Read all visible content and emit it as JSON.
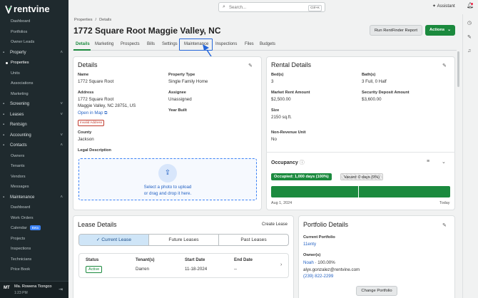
{
  "app": {
    "logo_text": "rentvine"
  },
  "sidebar": {
    "items": [
      {
        "type": "sub",
        "label": "Dashboard"
      },
      {
        "type": "sub",
        "label": "Portfolios"
      },
      {
        "type": "sub",
        "label": "Owner Leads"
      },
      {
        "type": "head",
        "label": "Property",
        "icon": "building-icon",
        "chev": "˄"
      },
      {
        "type": "sub",
        "label": "Properties",
        "active": true
      },
      {
        "type": "sub",
        "label": "Units"
      },
      {
        "type": "sub",
        "label": "Associations"
      },
      {
        "type": "sub",
        "label": "Marketing"
      },
      {
        "type": "head",
        "label": "Screening",
        "icon": "filter-icon",
        "chev": "˅"
      },
      {
        "type": "head",
        "label": "Leases",
        "icon": "document-icon",
        "chev": "˅"
      },
      {
        "type": "head",
        "label": "Rentsign",
        "icon": "signature-icon",
        "chev": ""
      },
      {
        "type": "head",
        "label": "Accounting",
        "icon": "calculator-icon",
        "chev": "˅"
      },
      {
        "type": "head",
        "label": "Contacts",
        "icon": "contacts-icon",
        "chev": "˄"
      },
      {
        "type": "sub",
        "label": "Owners"
      },
      {
        "type": "sub",
        "label": "Tenants"
      },
      {
        "type": "sub",
        "label": "Vendors"
      },
      {
        "type": "sub",
        "label": "Messages"
      },
      {
        "type": "head",
        "label": "Maintenance",
        "icon": "wrench-icon",
        "chev": "˄"
      },
      {
        "type": "sub",
        "label": "Dashboard"
      },
      {
        "type": "sub",
        "label": "Work Orders"
      },
      {
        "type": "sub",
        "label": "Calendar",
        "badge": "Beta"
      },
      {
        "type": "sub",
        "label": "Projects"
      },
      {
        "type": "sub",
        "label": "Inspections"
      },
      {
        "type": "sub",
        "label": "Technicians"
      },
      {
        "type": "sub",
        "label": "Price Book"
      }
    ],
    "user": {
      "initials": "MT",
      "name": "Ma. Rowena Tiongco",
      "time": "1:23 PM"
    }
  },
  "topbar": {
    "search_placeholder": "Search...",
    "shortcut": "Ctrl+K",
    "assistant_label": "Assistant"
  },
  "breadcrumb": {
    "root": "Properties",
    "current": "Details"
  },
  "header": {
    "title": "1772 Square Root Maggie Valley, NC",
    "rentfinder_button": "Run RentFinder Report",
    "actions_button": "Actions"
  },
  "tabs": [
    "Details",
    "Marketing",
    "Prospects",
    "Bills",
    "Settings",
    "Maintenance",
    "Inspections",
    "Files",
    "Budgets"
  ],
  "details": {
    "title": "Details",
    "name_label": "Name",
    "name": "1772 Square Root",
    "address_label": "Address",
    "address_line1": "1772 Square Root",
    "address_line2": "Maggie Valley, NC 28751, US",
    "open_map": "Open in Map",
    "invalid_badge": "Invalid Address",
    "county_label": "County",
    "county": "Jackson",
    "property_type_label": "Property Type",
    "property_type": "Single Family Home",
    "assignee_label": "Assignee",
    "assignee": "Unassigned",
    "year_built_label": "Year Built",
    "legal_label": "Legal Description",
    "upload_line1": "Select a photo to upload",
    "upload_line2": "or drag and drop it here."
  },
  "rental": {
    "title": "Rental Details",
    "beds_label": "Bed(s)",
    "beds": "3",
    "baths_label": "Bath(s)",
    "baths": "3 Full, 0 Half",
    "market_label": "Market Rent Amount",
    "market": "$2,500.00",
    "deposit_label": "Security Deposit Amount",
    "deposit": "$3,600.00",
    "size_label": "Size",
    "size": "2150 sq.ft.",
    "nonrev_label": "Non-Revenue Unit",
    "nonrev": "No"
  },
  "occupancy": {
    "title": "Occupancy",
    "occupied": "Occupied: 1,000 days (100%)",
    "vacant": "Vacant: 0 days (0%)",
    "start": "Aug 1, 2024",
    "end": "Today"
  },
  "lease": {
    "title": "Lease Details",
    "create": "Create Lease",
    "segments": [
      "Current Lease",
      "Future Leases",
      "Past Leases"
    ],
    "status_label": "Status",
    "status": "Active",
    "tenants_label": "Tenant(s)",
    "tenants": "Darren",
    "start_label": "Start Date",
    "start": "11-18-2024",
    "end_label": "End Date",
    "end": "--"
  },
  "portfolio": {
    "title": "Portfolio Details",
    "current_label": "Current Portfolio",
    "current": "11enty",
    "owners_label": "Owner(s)",
    "owner": "Noah",
    "owner_pct": "· 100.00%",
    "email": "alyx.gonzalez@rentvine.com",
    "phone": "(239) 822-2299",
    "change": "Change Portfolio"
  },
  "colors": {
    "brand_green": "#1b8a3e",
    "highlight_blue": "#2566d9",
    "link_blue": "#2563c4"
  }
}
